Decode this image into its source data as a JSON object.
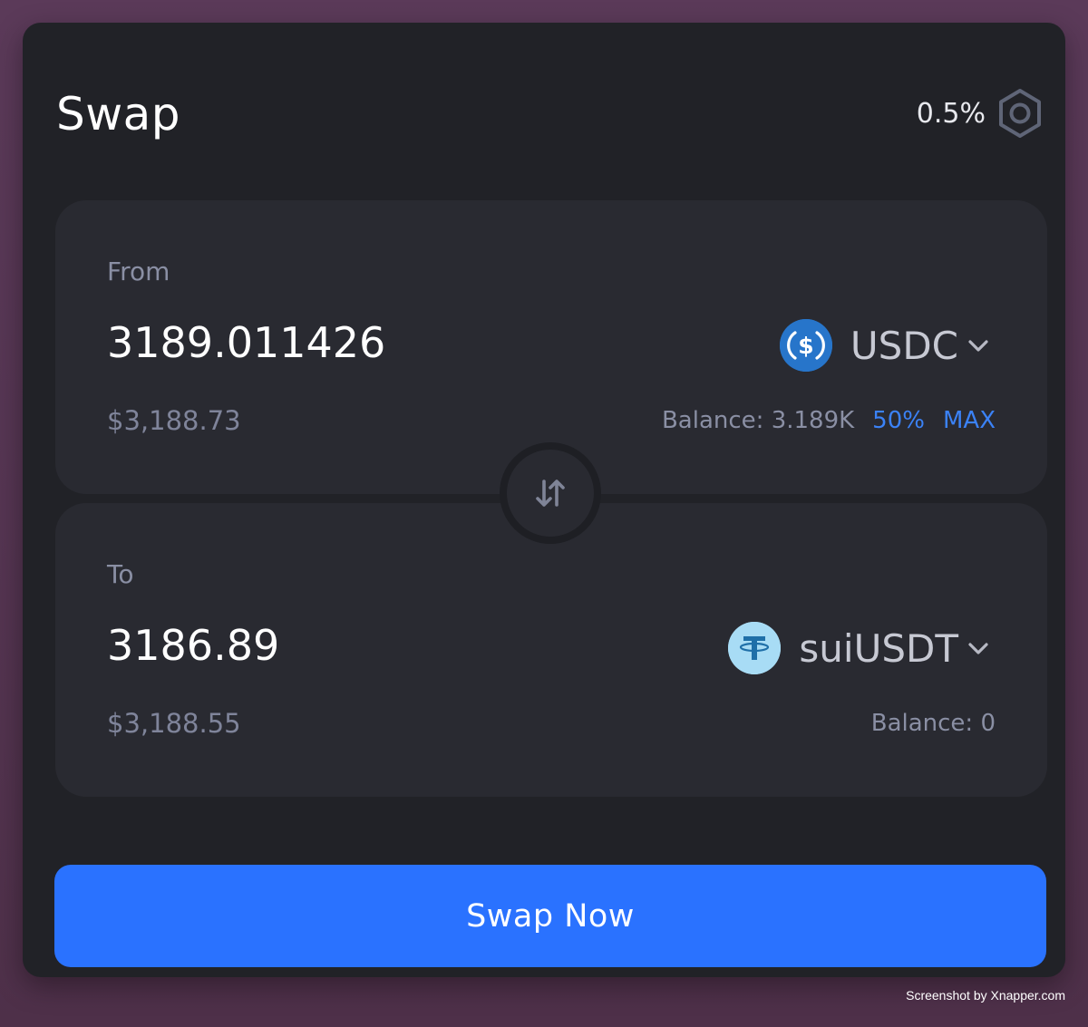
{
  "header": {
    "title": "Swap",
    "slippage": "0.5%",
    "settings_icon": "gear-hexagon-icon"
  },
  "from": {
    "label": "From",
    "amount": "3189.011426",
    "usd_value": "$3,188.73",
    "token": {
      "symbol": "USDC",
      "icon": "usdc-icon",
      "color": "#2775ca"
    },
    "balance": "Balance: 3.189K",
    "half_label": "50%",
    "max_label": "MAX"
  },
  "to": {
    "label": "To",
    "amount": "3186.89",
    "usd_value": "$3,188.55",
    "token": {
      "symbol": "suiUSDT",
      "icon": "tether-icon",
      "color": "#a8dcf5"
    },
    "balance": "Balance: 0"
  },
  "switch_icon": "swap-arrows-icon",
  "actions": {
    "swap_now_label": "Swap Now"
  },
  "footer": {
    "credit": "Screenshot by Xnapper.com"
  },
  "colors": {
    "accent": "#2a72ff",
    "card_bg": "#212227",
    "panel_bg": "#292a31"
  }
}
